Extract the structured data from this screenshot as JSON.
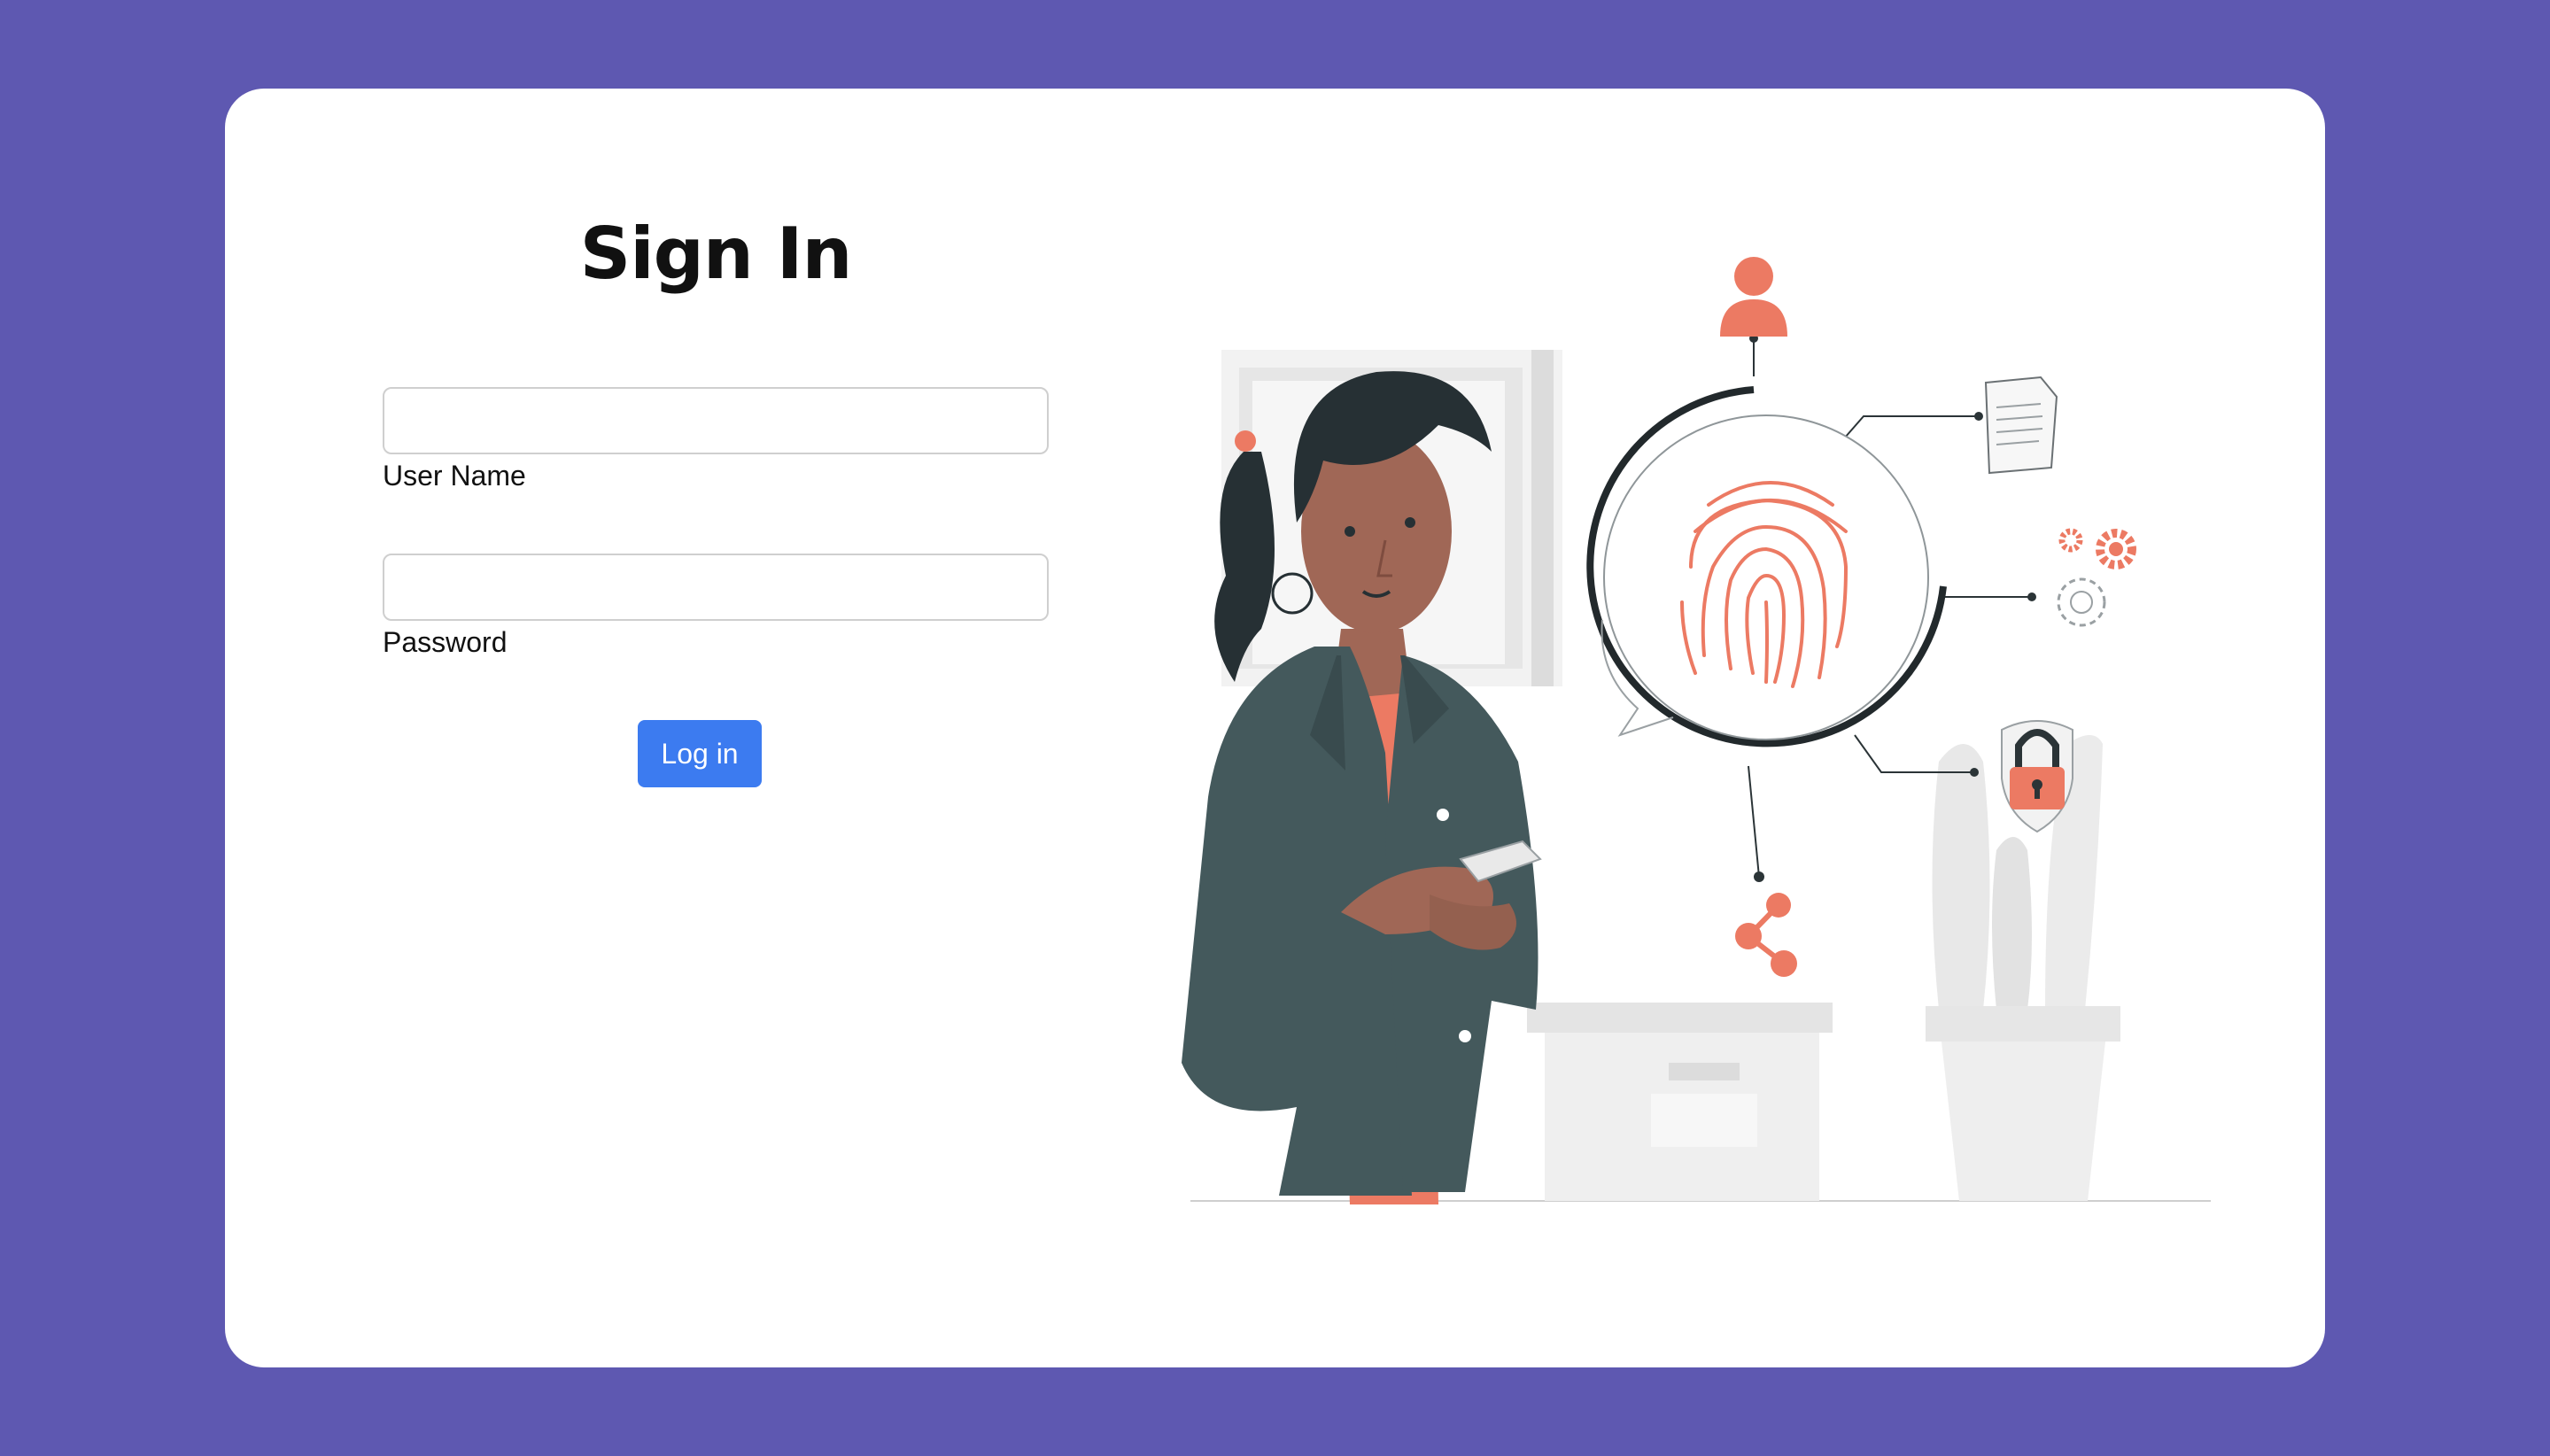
{
  "form": {
    "title": "Sign In",
    "username": {
      "label": "User Name",
      "value": "",
      "placeholder": ""
    },
    "password": {
      "label": "Password",
      "value": "",
      "placeholder": ""
    },
    "submit_label": "Log in"
  },
  "colors": {
    "background": "#5e58b1",
    "card": "#ffffff",
    "primary_button": "#3c7bf0",
    "accent": "#ec7a63",
    "jacket": "#44595c"
  },
  "illustration": {
    "icons": [
      "user-icon",
      "fingerprint-icon",
      "document-icon",
      "gears-icon",
      "lock-shield-icon",
      "share-icon"
    ]
  }
}
